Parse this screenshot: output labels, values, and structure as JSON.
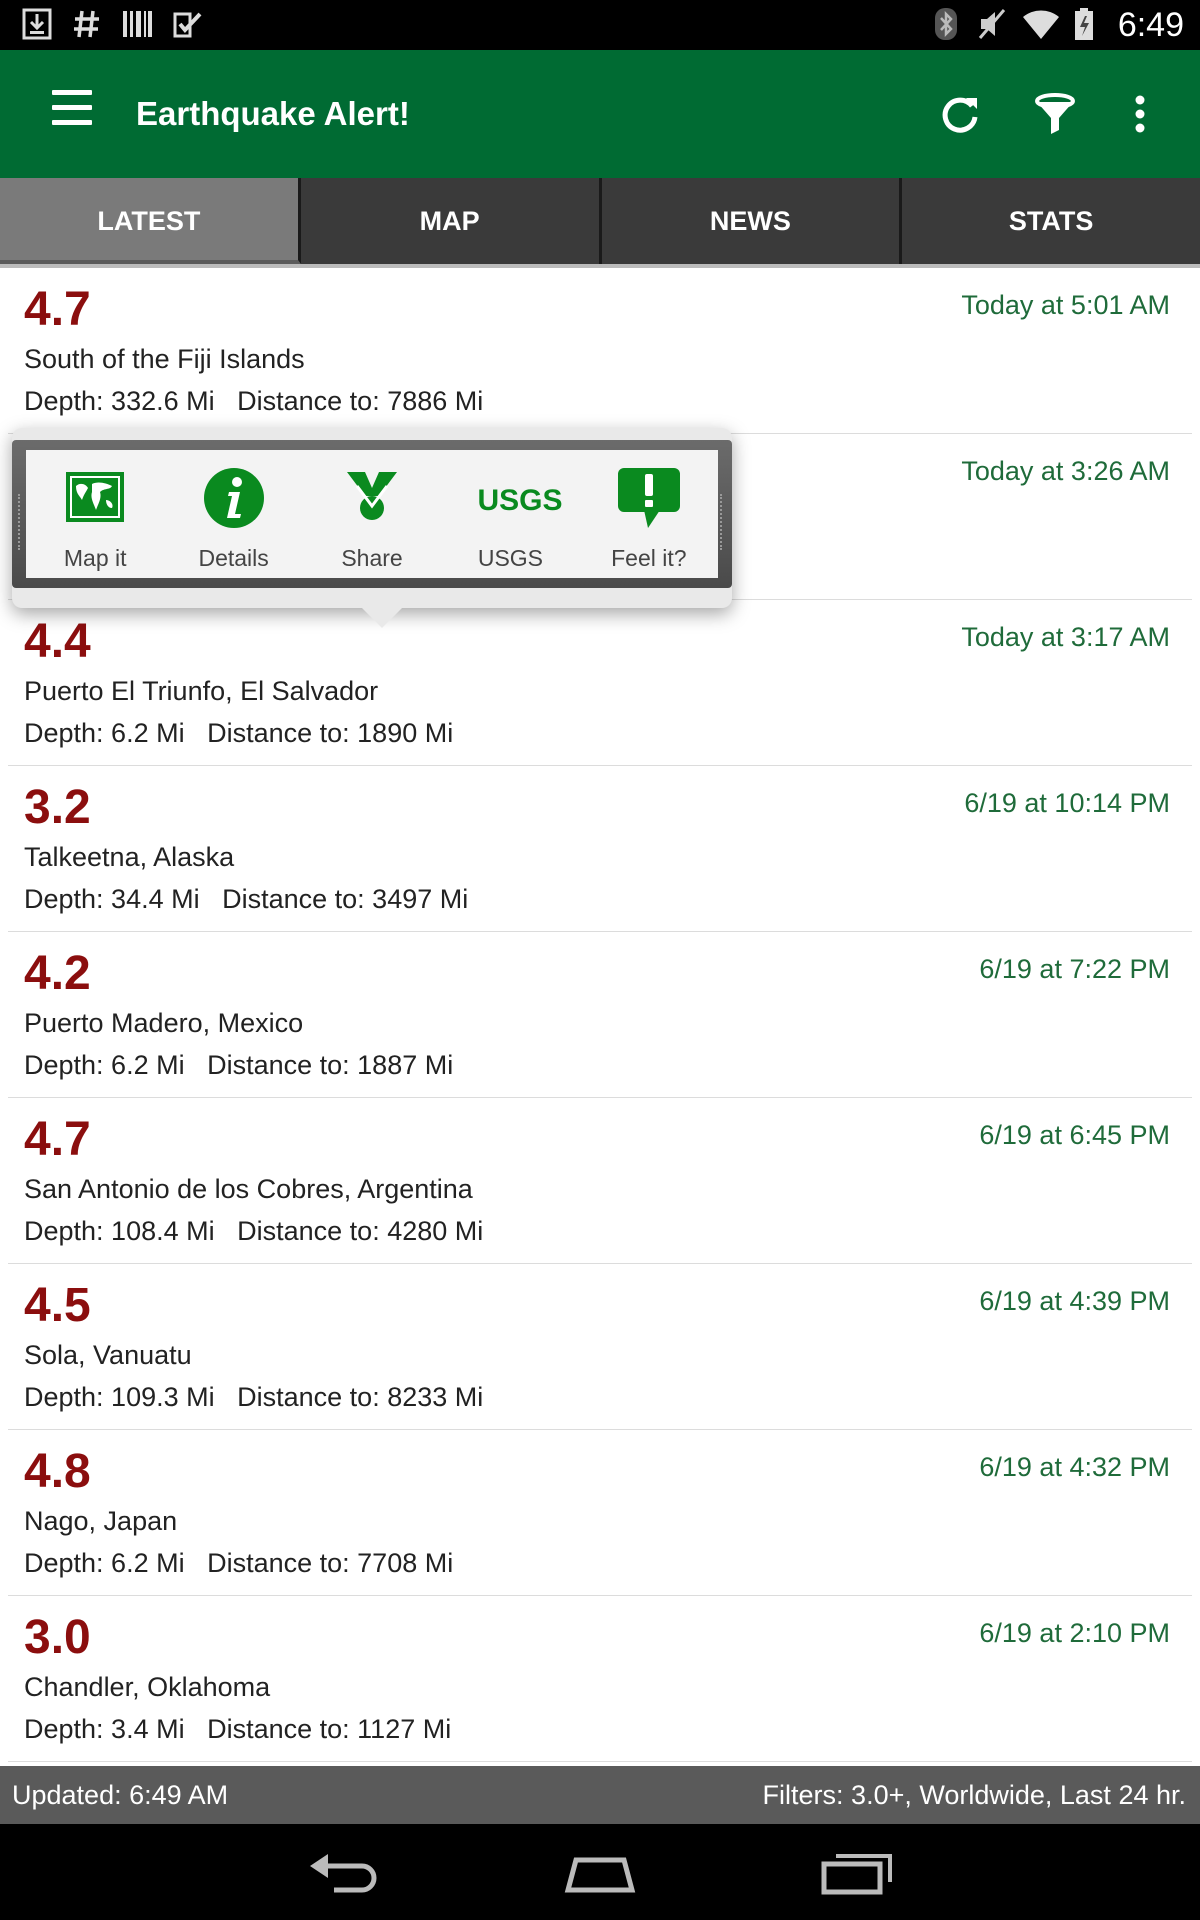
{
  "status_bar": {
    "time": "6:49",
    "left_icons": [
      "download-icon",
      "hash-icon",
      "barcode-icon",
      "tasks-icon"
    ],
    "right_icons": [
      "bluetooth-icon",
      "mute-icon",
      "wifi-icon",
      "battery-icon"
    ]
  },
  "app_bar": {
    "title": "Earthquake Alert!",
    "actions": [
      "refresh-icon",
      "filter-icon",
      "overflow-menu-icon"
    ],
    "brand_color": "#006b33"
  },
  "tabs": [
    {
      "label": "LATEST",
      "active": true
    },
    {
      "label": "MAP",
      "active": false
    },
    {
      "label": "NEWS",
      "active": false
    },
    {
      "label": "STATS",
      "active": false
    }
  ],
  "quakes": [
    {
      "magnitude": "4.7",
      "location": "South of the Fiji Islands",
      "depth": "Depth: 332.6 Mi",
      "distance": "Distance to: 7886 Mi",
      "time": "Today at 5:01 AM"
    },
    {
      "magnitude": "",
      "location": "",
      "depth": "",
      "distance": "",
      "time": "Today at 3:26 AM"
    },
    {
      "magnitude": "4.4",
      "location": "Puerto El Triunfo, El Salvador",
      "depth": "Depth: 6.2 Mi",
      "distance": "Distance to: 1890 Mi",
      "time": "Today at 3:17 AM"
    },
    {
      "magnitude": "3.2",
      "location": "Talkeetna, Alaska",
      "depth": "Depth: 34.4 Mi",
      "distance": "Distance to: 3497 Mi",
      "time": "6/19 at 10:14 PM"
    },
    {
      "magnitude": "4.2",
      "location": "Puerto Madero, Mexico",
      "depth": "Depth: 6.2 Mi",
      "distance": "Distance to: 1887 Mi",
      "time": "6/19 at 7:22 PM"
    },
    {
      "magnitude": "4.7",
      "location": "San Antonio de los Cobres, Argentina",
      "depth": "Depth: 108.4 Mi",
      "distance": "Distance to: 4280 Mi",
      "time": "6/19 at 6:45 PM"
    },
    {
      "magnitude": "4.5",
      "location": "Sola, Vanuatu",
      "depth": "Depth: 109.3 Mi",
      "distance": "Distance to: 8233 Mi",
      "time": "6/19 at 4:39 PM"
    },
    {
      "magnitude": "4.8",
      "location": "Nago, Japan",
      "depth": "Depth: 6.2 Mi",
      "distance": "Distance to: 7708 Mi",
      "time": "6/19 at 4:32 PM"
    },
    {
      "magnitude": "3.0",
      "location": "Chandler, Oklahoma",
      "depth": "Depth: 3.4 Mi",
      "distance": "Distance to: 1127 Mi",
      "time": "6/19 at 2:10 PM"
    }
  ],
  "quick_actions": [
    {
      "label": "Map it",
      "icon": "world-map-icon"
    },
    {
      "label": "Details",
      "icon": "info-icon"
    },
    {
      "label": "Share",
      "icon": "share-icon"
    },
    {
      "label": "USGS",
      "icon": "usgs-logo-icon",
      "logo_text": "USGS"
    },
    {
      "label": "Feel it?",
      "icon": "exclamation-bubble-icon"
    }
  ],
  "footer": {
    "updated": "Updated: 6:49 AM",
    "filters": "Filters: 3.0+, Worldwide, Last 24 hr."
  },
  "nav_bar": [
    "back-icon",
    "home-icon",
    "recent-apps-icon"
  ],
  "colors": {
    "magnitude": "#8b0e0e",
    "time": "#1f6b3a",
    "action_icon": "#0a8a1f"
  }
}
